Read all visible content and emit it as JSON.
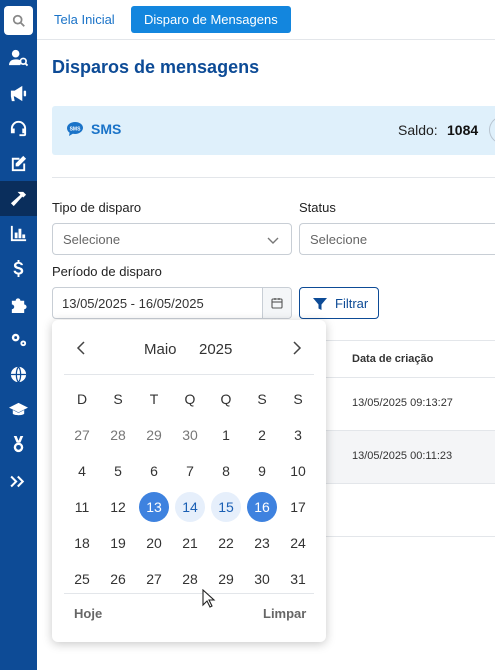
{
  "tabs": [
    {
      "label": "Tela Inicial"
    },
    {
      "label": "Disparo de Mensagens"
    }
  ],
  "page": {
    "title": "Disparos de mensagens"
  },
  "sms_card": {
    "label": "SMS",
    "saldo_label": "Saldo:",
    "saldo_value": "1084"
  },
  "filters": {
    "tipo_label": "Tipo de disparo",
    "tipo_value": "Selecione",
    "status_label": "Status",
    "status_value": "Selecione",
    "periodo_label": "Período de disparo",
    "periodo_value": "13/05/2025 - 16/05/2025",
    "filter_button": "Filtrar"
  },
  "table": {
    "header_date": "Data de criação",
    "rows": [
      {
        "date": "13/05/2025 09:13:27"
      },
      {
        "date": "13/05/2025 00:11:23"
      }
    ]
  },
  "calendar": {
    "month": "Maio",
    "year": "2025",
    "weekdays": [
      "D",
      "S",
      "T",
      "Q",
      "Q",
      "S",
      "S"
    ],
    "days": [
      [
        "27",
        "28",
        "29",
        "30",
        "1",
        "2",
        "3"
      ],
      [
        "4",
        "5",
        "6",
        "7",
        "8",
        "9",
        "10"
      ],
      [
        "11",
        "12",
        "13",
        "14",
        "15",
        "16",
        "17"
      ],
      [
        "18",
        "19",
        "20",
        "21",
        "22",
        "23",
        "24"
      ],
      [
        "25",
        "26",
        "27",
        "28",
        "29",
        "30",
        "31"
      ]
    ],
    "selected_start": "13",
    "selected_end": "16",
    "today_label": "Hoje",
    "clear_label": "Limpar"
  },
  "sidebar": {
    "icons": [
      "search-icon",
      "user-search-icon",
      "megaphone-icon",
      "headset-icon",
      "edit-icon",
      "hammer-icon",
      "chart-icon",
      "dollar-icon",
      "puzzle-icon",
      "cogs-icon",
      "globe-icon",
      "graduation-icon",
      "medal-icon",
      "expand-icon"
    ]
  }
}
